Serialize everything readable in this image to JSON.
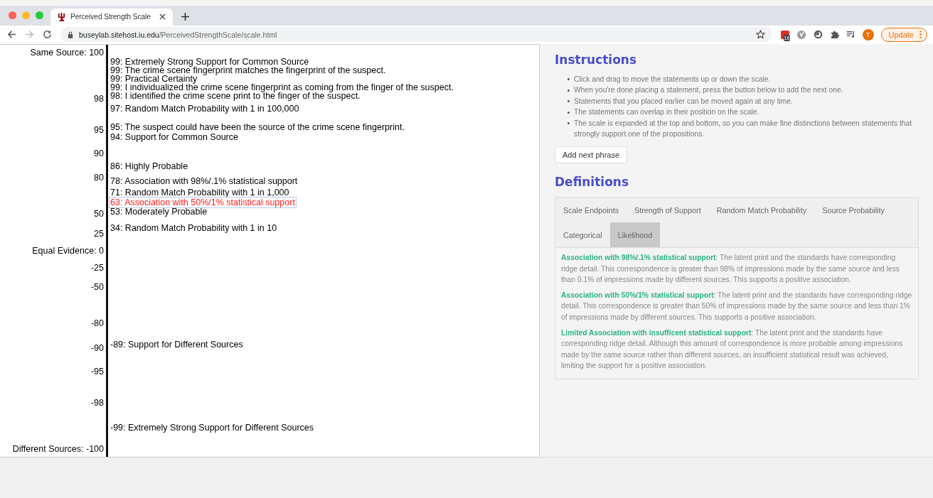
{
  "browser": {
    "tab_title": "Perceived Strength Scale",
    "url_host": "buseylab.sitehost.iu.edu",
    "url_path": "/PerceivedStrengthScale/scale.html",
    "extension_badge": "16",
    "avatar": "T",
    "update_button": "Update"
  },
  "scale": {
    "ticks": [
      "Same Source: 100",
      "98",
      "95",
      "90",
      "80",
      "50",
      "25",
      "Equal Evidence: 0",
      "-25",
      "-50",
      "-80",
      "-90",
      "-95",
      "-98",
      "Different Sources: -100"
    ],
    "statements": [
      {
        "text": "99: Extremely Strong Support for Common Source",
        "selected": false
      },
      {
        "text": "99: The crime scene fingerprint matches the fingerprint of the suspect.",
        "selected": false
      },
      {
        "text": "99: Practical Certainty",
        "selected": false
      },
      {
        "text": "99: I individualized the crime scene fingerprint as coming from the finger of the suspect.",
        "selected": false
      },
      {
        "text": "98: I identified the crime scene print to the finger of the suspect.",
        "selected": false
      },
      {
        "text": "97: Random Match Probability with 1 in 100,000",
        "selected": false
      },
      {
        "text": "95: The suspect could have been the source of the crime scene fingerprint.",
        "selected": false
      },
      {
        "text": "94: Support for Common Source",
        "selected": false
      },
      {
        "text": "86: Highly Probable",
        "selected": false
      },
      {
        "text": "78: Association with 98%/.1% statistical support",
        "selected": false
      },
      {
        "text": "71: Random Match Probability with 1 in 1,000",
        "selected": false
      },
      {
        "text": "63: Association with 50%/1% statistical support",
        "selected": true
      },
      {
        "text": "53: Moderately Probable",
        "selected": false
      },
      {
        "text": "34: Random Match Probability with 1 in 10",
        "selected": false
      },
      {
        "text": "-89: Support for Different Sources",
        "selected": false
      },
      {
        "text": "-99: Extremely Strong Support for Different Sources",
        "selected": false
      }
    ]
  },
  "instructions": {
    "heading": "Instructions",
    "items": [
      "Click and drag to move the statements up or down the scale.",
      "When you're done placing a statement, press the button below to add the next one.",
      "Statements that you placed earlier can be moved again at any time.",
      "The statements can overlap in their position on the scale.",
      "The scale is expanded at the top and bottom, so you can make fine distinctions between statements that strongly support one of the propositions."
    ],
    "button": "Add next phrase"
  },
  "definitions": {
    "heading": "Definitions",
    "tabs": [
      {
        "label": "Scale Endpoints",
        "selected": false
      },
      {
        "label": "Strength of Support",
        "selected": false
      },
      {
        "label": "Random Match Probability",
        "selected": false
      },
      {
        "label": "Source Probability",
        "selected": false
      },
      {
        "label": "Categorical",
        "selected": false
      },
      {
        "label": "Likelihood",
        "selected": true
      }
    ],
    "entries": [
      "**Association with 98%/.1% statistical support**: The latent print and the standards have corresponding ridge detail. This correspondence is greater than 98% of impressions made by the same source and less than 0.1% of impressions made by different sources. This supports a positive association.",
      "**Association with 50%/1% statistical support**: The latent print and the standards have corresponding ridge detail. This correspondence is greater than 50% of impressions made by the same source and less than 1% of impressions made by different sources. This supports a positive association.",
      "**Limited Association with insufficent statistical support**: The latent print and the standards have corresponding ridge detail. Although this amount of correspondence is more probable among impressions made by the same source rather than different sources, an insufficient statistical result was achieved, limiting the support for a positive association."
    ]
  }
}
